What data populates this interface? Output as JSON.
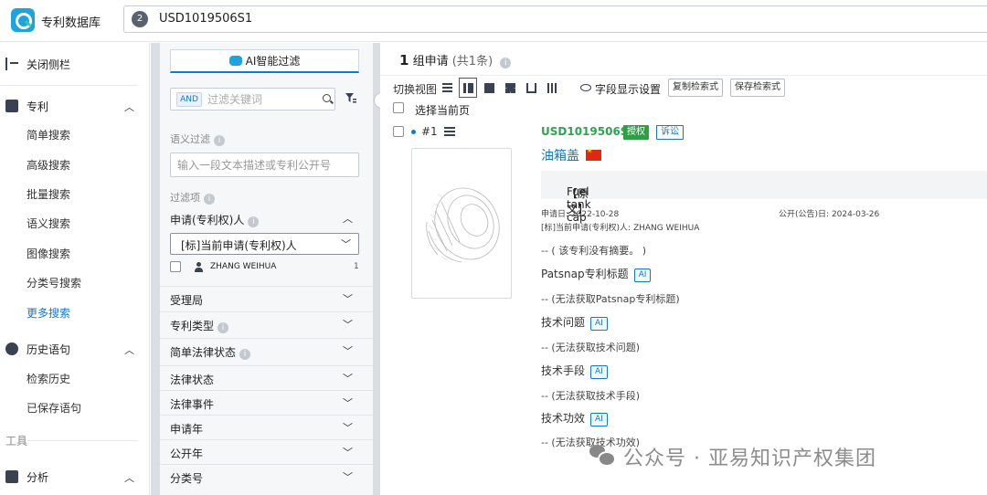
{
  "app": {
    "title": "专利数据库"
  },
  "search": {
    "count": "2",
    "query": "USD1019506S1"
  },
  "leftnav": {
    "close_sidebar": "关闭侧栏",
    "patent": "专利",
    "patent_items": [
      "简单搜索",
      "高级搜索",
      "批量搜索",
      "语义搜索",
      "图像搜索",
      "分类号搜索",
      "更多搜索"
    ],
    "history": "历史语句",
    "history_items": [
      "检索历史",
      "已保存语句"
    ],
    "tools_section": "工具",
    "analysis": "分析"
  },
  "filter": {
    "ai_filter": "AI智能过滤",
    "and_label": "AND",
    "keyword_placeholder": "过滤关键词",
    "semantic_label": "语义过滤",
    "semantic_placeholder": "输入一段文本描述或专利公开号",
    "filter_items_label": "过滤项",
    "applicant_facet": "申请(专利权)人",
    "applicant_select": "[标]当前申请(专利权)人",
    "applicant_option": "ZHANG WEIHUA",
    "applicant_option_count": "1",
    "facets": [
      "受理局",
      "专利类型",
      "简单法律状态",
      "法律状态",
      "法律事件",
      "申请年",
      "公开年",
      "分类号"
    ]
  },
  "main": {
    "group_count": "1",
    "group_label": "组申请",
    "total": "(共1条)",
    "view_label": "切换视图",
    "fields_label": "字段显示设置",
    "copy_query": "复制检索式",
    "save_query": "保存检索式",
    "select_page": "选择当前页",
    "record": {
      "index": "#1",
      "pub_no": "USD1019506S1",
      "status": "授权",
      "litigation": "诉讼",
      "title": "油箱盖",
      "original_label": "【原文】",
      "original_title": "Fuel tank cap",
      "filing_date_label": "申请日:",
      "filing_date": "2022-10-28",
      "pub_date_label": "公开(公告)日:",
      "pub_date": "2024-03-26",
      "assignee_label": "[标]当前申请(专利权)人:",
      "assignee": "ZHANG WEIHUA",
      "abstract_missing": "-- ( 该专利没有摘要。 )",
      "ai_tag": "AI",
      "fields": [
        {
          "title": "Patsnap专利标题",
          "value": "-- (无法获取Patsnap专利标题)"
        },
        {
          "title": "技术问题",
          "value": "-- (无法获取技术问题)"
        },
        {
          "title": "技术手段",
          "value": "-- (无法获取技术手段)"
        },
        {
          "title": "技术功效",
          "value": "-- (无法获取技术功效)"
        }
      ]
    }
  },
  "watermark": "公众号 · 亚易知识产权集团"
}
